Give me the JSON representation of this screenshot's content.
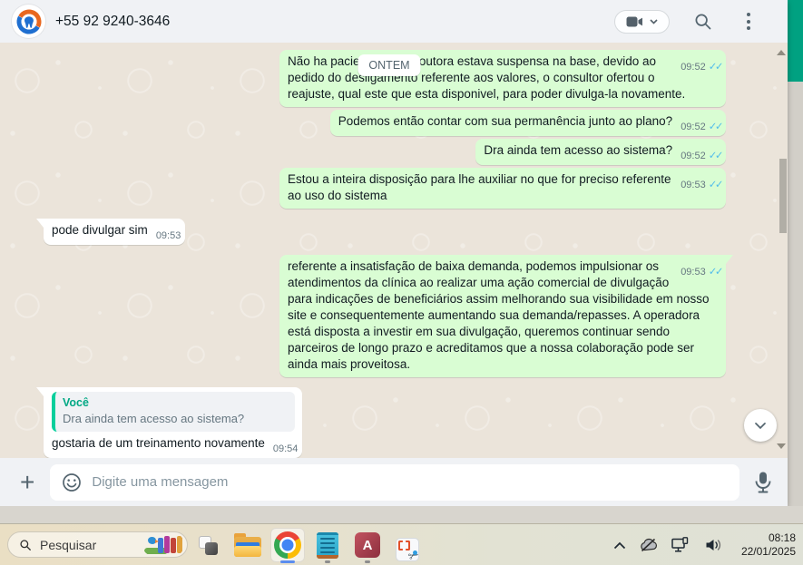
{
  "colors": {
    "accent-strip": "#00a181",
    "panel-bg": "#f0f2f5",
    "bubble-out": "#d9fdd3",
    "bubble-in": "#ffffff",
    "tick-blue": "#53bdeb",
    "quote-accent": "#06cf9c"
  },
  "header": {
    "contact_phone": "+55 92 9240-3646"
  },
  "chat": {
    "date_badge": "ONTEM",
    "messages": [
      {
        "direction": "out",
        "group_start": true,
        "text": "Não ha pacientes pois doutora estava suspensa na base, devido ao pedido do desligamento referente aos valores, o consultor ofertou o reajuste, qual este que esta disponivel, para poder divulga-la novamente.",
        "time": "09:52",
        "ticks": true
      },
      {
        "direction": "out",
        "text": "Podemos então contar com sua permanência junto ao plano?",
        "time": "09:52",
        "ticks": true
      },
      {
        "direction": "out",
        "text": "Dra ainda tem acesso ao sistema?",
        "time": "09:52",
        "ticks": true
      },
      {
        "direction": "out",
        "text": "Estou a inteira disposição para lhe auxiliar no que for preciso referente ao uso do sistema",
        "time": "09:53",
        "ticks": true
      },
      {
        "direction": "in",
        "group_start": true,
        "tail": true,
        "text": "pode divulgar sim",
        "time": "09:53",
        "ticks": false
      },
      {
        "direction": "out",
        "group_start": true,
        "tail": true,
        "text": "referente a insatisfação de baixa demanda, podemos impulsionar os atendimentos da clínica ao realizar uma ação comercial de divulgação para indicações de beneficiários assim melhorando sua visibilidade em nosso site e consequentemente aumentando sua demanda/repasses. A operadora está disposta a investir em sua divulgação, queremos continuar sendo parceiros de longo prazo e acreditamos que a nossa colaboração pode ser ainda mais proveitosa.",
        "time": "09:53",
        "ticks": true
      },
      {
        "direction": "in",
        "group_start": true,
        "tail": true,
        "quote": {
          "author": "Você",
          "text": "Dra ainda tem acesso ao sistema?"
        },
        "text": "gostaria de um treinamento novamente",
        "time": "09:54",
        "ticks": false
      },
      {
        "direction": "out",
        "group_start": true,
        "tail": true,
        "partial": true
      }
    ],
    "ticks_glyph": "✓✓"
  },
  "composer": {
    "plus_glyph": "+",
    "placeholder": "Digite uma mensagem"
  },
  "taskbar": {
    "search_label": "Pesquisar",
    "access_letter": "A",
    "clock_time": "08:18",
    "clock_date": "22/01/2025"
  },
  "icons": {
    "header": [
      "video-call-camera",
      "chevron-down",
      "magnifier",
      "kebab-menu"
    ],
    "composer": [
      "plus",
      "emoji-smiley",
      "microphone"
    ],
    "chat": [
      "scroll-down-chevron",
      "read-ticks"
    ],
    "taskbar_apps": [
      "task-view",
      "file-explorer",
      "chrome",
      "notepad",
      "access",
      "snipping-tool"
    ],
    "tray": [
      "chevron-up",
      "onedrive-slash",
      "pc-network",
      "speaker"
    ]
  }
}
